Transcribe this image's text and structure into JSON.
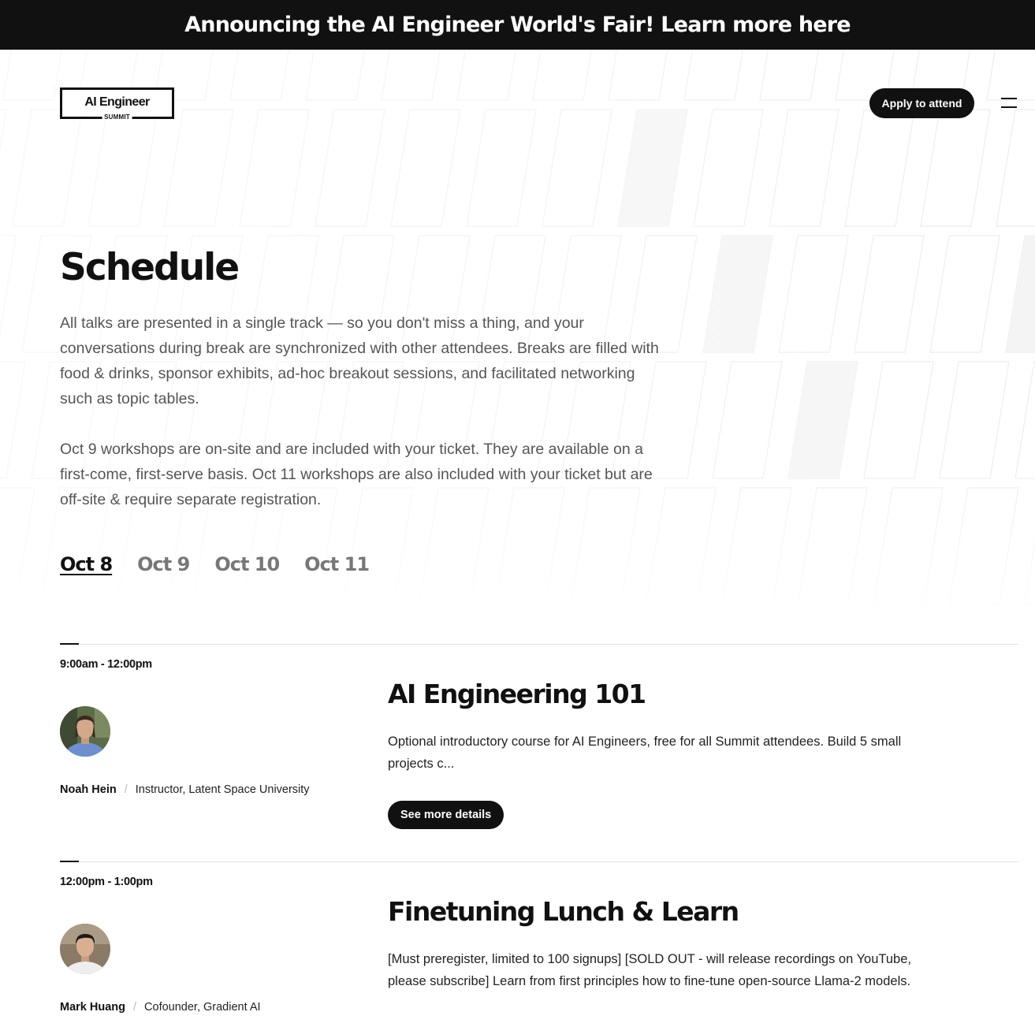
{
  "banner": {
    "text": "Announcing the AI Engineer World's Fair! Learn more here"
  },
  "header": {
    "logo_main": "AI Engineer",
    "logo_sub": "SUMMIT",
    "apply_label": "Apply to attend",
    "menu_icon": "hamburger-menu-icon"
  },
  "page": {
    "title": "Schedule",
    "intro_1": "All talks are presented in a single track — so you don't miss a thing, and your conversations during break are synchronized with other attendees. Breaks are filled with food & drinks, sponsor exhibits, ad-hoc breakout sessions, and facilitated networking such as topic tables.",
    "intro_2": "Oct 9 workshops are on-site and are included with your ticket. They are available on a first-come, first-serve basis. Oct 11 workshops are also included with your ticket but are off-site & require separate registration."
  },
  "tabs": [
    {
      "label": "Oct 8",
      "active": true
    },
    {
      "label": "Oct 9",
      "active": false
    },
    {
      "label": "Oct 10",
      "active": false
    },
    {
      "label": "Oct 11",
      "active": false
    }
  ],
  "sessions": [
    {
      "time": "9:00am - 12:00pm",
      "speaker_name": "Noah Hein",
      "speaker_role": "Instructor, Latent Space University",
      "title": "AI Engineering 101",
      "description": "Optional introductory course for AI Engineers, free for all Summit attendees. Build 5 small projects c...",
      "button_label": "See more details"
    },
    {
      "time": "12:00pm - 1:00pm",
      "speaker_name": "Mark Huang",
      "speaker_role": "Cofounder, Gradient AI",
      "title": "Finetuning Lunch & Learn",
      "description": "[Must preregister, limited to 100 signups] [SOLD OUT - will release recordings on YouTube, please subscribe] Learn from first principles how to fine-tune open-source Llama-2 models."
    }
  ],
  "colors": {
    "ink": "#111111",
    "muted_text": "#555555",
    "inactive_tab": "#777777",
    "divider": "#e4e4e4"
  }
}
